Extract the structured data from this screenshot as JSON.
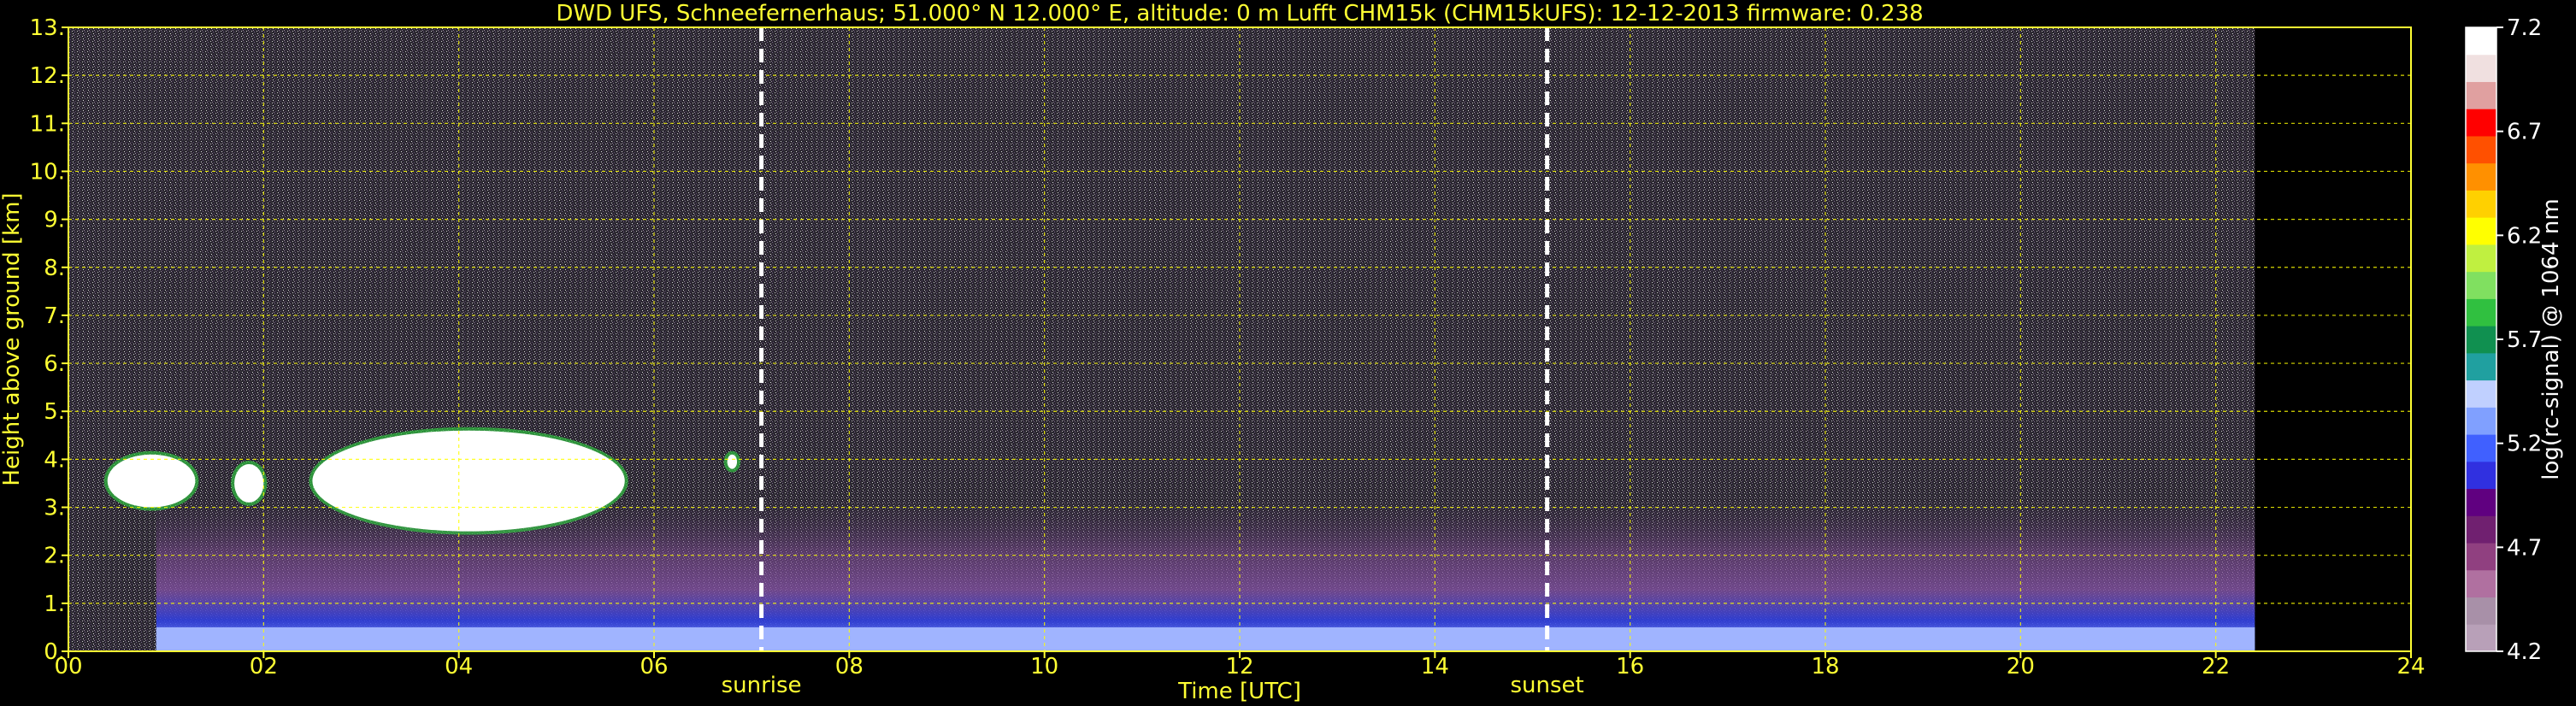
{
  "chart_data": {
    "type": "heatmap",
    "title": "DWD UFS, Schneefernerhaus; 51.000° N 12.000° E, altitude: 0 m    Lufft CHM15k (CHM15kUFS): 12-12-2013    firmware: 0.238",
    "xlabel": "Time [UTC]",
    "ylabel": "Height above ground [km]",
    "x_unit": "hours UTC",
    "xlim": [
      0,
      24
    ],
    "ylim": [
      0,
      13
    ],
    "x_ticks": [
      "00",
      "02",
      "04",
      "06",
      "08",
      "10",
      "12",
      "14",
      "16",
      "18",
      "20",
      "22",
      "24"
    ],
    "y_ticks": [
      "0.",
      "1.",
      "2.",
      "3.",
      "4.",
      "5.",
      "6.",
      "7.",
      "8.",
      "9.",
      "10.",
      "11.",
      "12.",
      "13."
    ],
    "grid": true,
    "grid_color": "#ffff00",
    "data_end_hour": 22.4,
    "events": [
      {
        "label": "sunrise",
        "hour": 7.1
      },
      {
        "label": "sunset",
        "hour": 15.15
      }
    ],
    "clouds": [
      {
        "hour_start": 0.4,
        "hour_end": 1.3,
        "base_km": 3.0,
        "top_km": 4.1
      },
      {
        "hour_start": 1.7,
        "hour_end": 2.0,
        "base_km": 3.1,
        "top_km": 3.9
      },
      {
        "hour_start": 2.5,
        "hour_end": 5.7,
        "base_km": 2.5,
        "top_km": 4.6
      },
      {
        "hour_start": 6.75,
        "hour_end": 6.85,
        "base_km": 3.8,
        "top_km": 4.1
      }
    ],
    "colorbar": {
      "label": "log(rc-signal) @ 1064 nm",
      "range": [
        4.2,
        7.2
      ],
      "ticks": [
        "4.2",
        "4.7",
        "5.2",
        "5.7",
        "6.2",
        "6.7",
        "7.2"
      ],
      "colors": [
        "#b8a0b8",
        "#a890a8",
        "#b070a0",
        "#904080",
        "#702070",
        "#600080",
        "#3030e0",
        "#4060ff",
        "#80a0ff",
        "#c0d0ff",
        "#20a0a0",
        "#109050",
        "#30c040",
        "#80e060",
        "#c0f040",
        "#ffff00",
        "#ffd000",
        "#ff9000",
        "#ff5000",
        "#ff0000",
        "#e0a0a0",
        "#f0e0e0",
        "#ffffff"
      ]
    }
  }
}
